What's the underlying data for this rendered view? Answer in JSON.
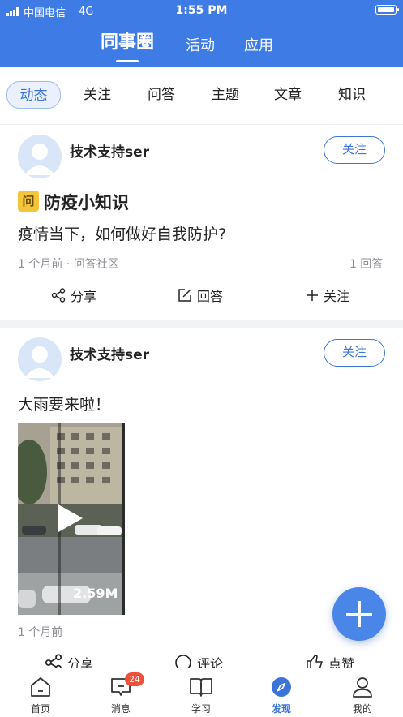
{
  "status_bar": {
    "carrier": "中国电信",
    "network": "4G",
    "time": "1:55 PM"
  },
  "top_tabs": [
    {
      "label": "同事圈",
      "active": true
    },
    {
      "label": "活动",
      "active": false
    },
    {
      "label": "应用",
      "active": false
    }
  ],
  "sub_tabs": [
    {
      "label": "动态",
      "active": true
    },
    {
      "label": "关注",
      "active": false
    },
    {
      "label": "问答",
      "active": false
    },
    {
      "label": "主题",
      "active": false
    },
    {
      "label": "文章",
      "active": false
    },
    {
      "label": "知识",
      "active": false
    }
  ],
  "posts": [
    {
      "author": "技术支持ser",
      "follow_label": "关注",
      "badge": "问",
      "title": "防疫小知识",
      "body": "疫情当下，如何做好自我防护?",
      "meta": "1 个月前 · 问答社区",
      "answers": "1 回答",
      "actions": [
        "分享",
        "回答",
        "关注"
      ]
    },
    {
      "author": "技术支持ser",
      "follow_label": "关注",
      "text": "大雨要来啦！",
      "video_duration": "2.59M",
      "meta": "1 个月前",
      "actions": [
        "分享",
        "评论",
        "点赞"
      ]
    }
  ],
  "bottom_nav": [
    {
      "label": "首页",
      "icon": "home-icon",
      "active": false
    },
    {
      "label": "消息",
      "icon": "message-icon",
      "active": false,
      "badge": "24"
    },
    {
      "label": "学习",
      "icon": "book-icon",
      "active": false
    },
    {
      "label": "发现",
      "icon": "compass-icon",
      "active": true
    },
    {
      "label": "我的",
      "icon": "person-icon",
      "active": false
    }
  ],
  "colors": {
    "primary": "#3f7be4",
    "accent": "#3a74d8",
    "badge_red": "#f0503a",
    "question_badge": "#f4c53a"
  }
}
